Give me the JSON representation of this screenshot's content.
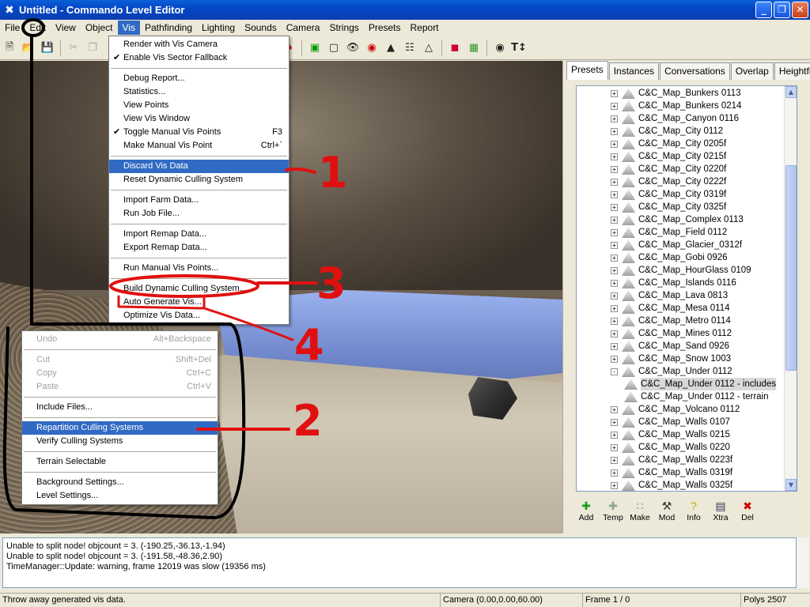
{
  "window": {
    "title": "Untitled - Commando Level Editor"
  },
  "menubar": [
    "File",
    "Edit",
    "View",
    "Object",
    "Vis",
    "Pathfinding",
    "Lighting",
    "Sounds",
    "Camera",
    "Strings",
    "Presets",
    "Report"
  ],
  "vis_menu": {
    "groups": [
      [
        {
          "label": "Render with Vis Camera",
          "check": false,
          "accel": ""
        },
        {
          "label": "Enable Vis Sector Fallback",
          "check": true,
          "accel": ""
        }
      ],
      [
        {
          "label": "Debug Report...",
          "check": false,
          "accel": ""
        },
        {
          "label": "Statistics...",
          "check": false,
          "accel": ""
        },
        {
          "label": "View Points",
          "check": false,
          "accel": ""
        },
        {
          "label": "View Vis Window",
          "check": false,
          "accel": ""
        },
        {
          "label": "Toggle Manual Vis Points",
          "check": true,
          "accel": "F3"
        },
        {
          "label": "Make Manual Vis Point",
          "check": false,
          "accel": "Ctrl+`"
        }
      ],
      [
        {
          "label": "Discard Vis Data",
          "check": false,
          "accel": "",
          "highlight": true
        },
        {
          "label": "Reset Dynamic Culling System",
          "check": false,
          "accel": ""
        }
      ],
      [
        {
          "label": "Import Farm Data...",
          "check": false,
          "accel": ""
        },
        {
          "label": "Run Job File...",
          "check": false,
          "accel": ""
        }
      ],
      [
        {
          "label": "Import Remap Data...",
          "check": false,
          "accel": ""
        },
        {
          "label": "Export Remap Data...",
          "check": false,
          "accel": ""
        }
      ],
      [
        {
          "label": "Run Manual Vis Points...",
          "check": false,
          "accel": ""
        }
      ],
      [
        {
          "label": "Build Dynamic Culling System...",
          "check": false,
          "accel": ""
        },
        {
          "label": "Auto Generate Vis...",
          "check": false,
          "accel": ""
        },
        {
          "label": "Optimize Vis Data...",
          "check": false,
          "accel": ""
        }
      ]
    ]
  },
  "edit_menu": {
    "groups": [
      [
        {
          "label": "Undo",
          "accel": "Alt+Backspace",
          "disabled": true
        }
      ],
      [
        {
          "label": "Cut",
          "accel": "Shift+Del",
          "disabled": true
        },
        {
          "label": "Copy",
          "accel": "Ctrl+C",
          "disabled": true
        },
        {
          "label": "Paste",
          "accel": "Ctrl+V",
          "disabled": true
        }
      ],
      [
        {
          "label": "Include Files...",
          "accel": "",
          "disabled": false
        }
      ],
      [
        {
          "label": "Repartition Culling Systems",
          "accel": "",
          "disabled": false,
          "highlight": true
        },
        {
          "label": "Verify Culling Systems",
          "accel": "",
          "disabled": false
        }
      ],
      [
        {
          "label": "Terrain Selectable",
          "accel": "",
          "disabled": false
        }
      ],
      [
        {
          "label": "Background Settings...",
          "accel": "",
          "disabled": false
        },
        {
          "label": "Level Settings...",
          "accel": "",
          "disabled": false
        }
      ]
    ]
  },
  "right_panel": {
    "tabs": [
      "Presets",
      "Instances",
      "Conversations",
      "Overlap",
      "Heightfield"
    ],
    "tree": [
      {
        "label": "C&C_Map_Bunkers 0113",
        "exp": "+"
      },
      {
        "label": "C&C_Map_Bunkers 0214",
        "exp": "+"
      },
      {
        "label": "C&C_Map_Canyon 0116",
        "exp": "+"
      },
      {
        "label": "C&C_Map_City 0112",
        "exp": "+"
      },
      {
        "label": "C&C_Map_City 0205f",
        "exp": "+"
      },
      {
        "label": "C&C_Map_City 0215f",
        "exp": "+"
      },
      {
        "label": "C&C_Map_City 0220f",
        "exp": "+"
      },
      {
        "label": "C&C_Map_City 0222f",
        "exp": "+"
      },
      {
        "label": "C&C_Map_City 0319f",
        "exp": "+"
      },
      {
        "label": "C&C_Map_City 0325f",
        "exp": "+"
      },
      {
        "label": "C&C_Map_Complex 0113",
        "exp": "+"
      },
      {
        "label": "C&C_Map_Field 0112",
        "exp": "+"
      },
      {
        "label": "C&C_Map_Glacier_0312f",
        "exp": "+"
      },
      {
        "label": "C&C_Map_Gobi 0926",
        "exp": "+"
      },
      {
        "label": "C&C_Map_HourGlass 0109",
        "exp": "+"
      },
      {
        "label": "C&C_Map_Islands 0116",
        "exp": "+"
      },
      {
        "label": "C&C_Map_Lava 0813",
        "exp": "+"
      },
      {
        "label": "C&C_Map_Mesa 0114",
        "exp": "+"
      },
      {
        "label": "C&C_Map_Metro 0114",
        "exp": "+"
      },
      {
        "label": "C&C_Map_Mines 0112",
        "exp": "+"
      },
      {
        "label": "C&C_Map_Sand 0926",
        "exp": "+"
      },
      {
        "label": "C&C_Map_Snow 1003",
        "exp": "+"
      },
      {
        "label": "C&C_Map_Under 0112",
        "exp": "-"
      },
      {
        "label": "C&C_Map_Under 0112 - includes",
        "child": true,
        "selected": true
      },
      {
        "label": "C&C_Map_Under 0112 - terrain",
        "child": true
      },
      {
        "label": "C&C_Map_Volcano 0112",
        "exp": "+"
      },
      {
        "label": "C&C_Map_Walls 0107",
        "exp": "+"
      },
      {
        "label": "C&C_Map_Walls 0215",
        "exp": "+"
      },
      {
        "label": "C&C_Map_Walls 0220",
        "exp": "+"
      },
      {
        "label": "C&C_Map_Walls 0223f",
        "exp": "+"
      },
      {
        "label": "C&C_Map_Walls 0319f",
        "exp": "+"
      },
      {
        "label": "C&C_Map_Walls 0325f",
        "exp": "+"
      }
    ],
    "buttons": [
      {
        "label": "Add",
        "icon": "plus-icon"
      },
      {
        "label": "Temp",
        "icon": "temp-icon"
      },
      {
        "label": "Make",
        "icon": "make-icon"
      },
      {
        "label": "Mod",
        "icon": "hammer-icon"
      },
      {
        "label": "Info",
        "icon": "info-icon"
      },
      {
        "label": "Xtra",
        "icon": "xtra-icon"
      },
      {
        "label": "Del",
        "icon": "delete-icon"
      }
    ]
  },
  "log": [
    "Unable to split node!  objcount = 3. (-190.25,-36.13,-1.94)",
    "Unable to split node!  objcount = 3. (-191.58,-48.36,2.90)",
    "TimeManager::Update: warning, frame 12019 was slow (19356 ms)"
  ],
  "status": {
    "hint": "Throw away generated vis data.",
    "camera": "Camera (0.00,0.00,60.00)",
    "frame": "Frame 1 / 0",
    "polys": "Polys 2507"
  },
  "annotations": [
    "1",
    "2",
    "3",
    "4"
  ],
  "colors": {
    "annotation_red": "#e01010",
    "highlight": "#316ac5",
    "titlebar": "#0347c6"
  }
}
